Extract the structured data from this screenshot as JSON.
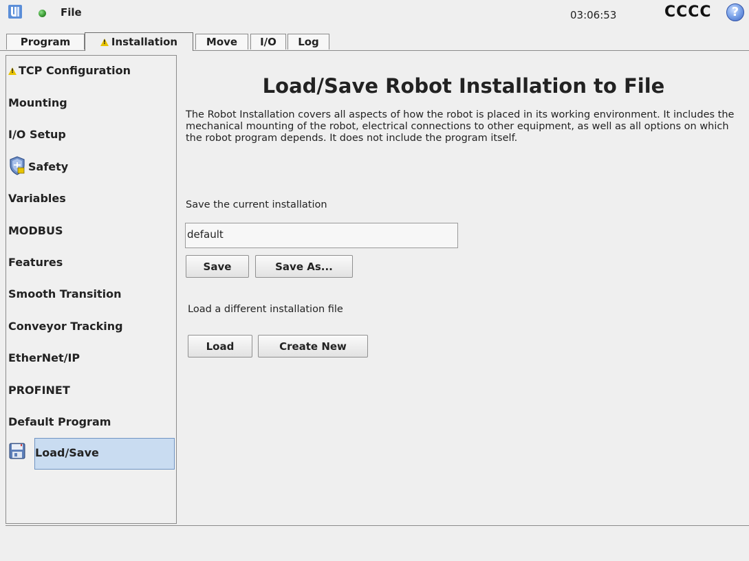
{
  "header": {
    "file_label": "File",
    "clock": "03:06:53",
    "robot_name": "CCCC",
    "help_symbol": "?",
    "status_color": "#3a9a33"
  },
  "tabs": [
    {
      "label": "Program",
      "active": false
    },
    {
      "label": "Installation",
      "active": true,
      "warning": true
    },
    {
      "label": "Move",
      "active": false
    },
    {
      "label": "I/O",
      "active": false
    },
    {
      "label": "Log",
      "active": false
    }
  ],
  "sidebar": {
    "items": [
      {
        "label": "TCP Configuration",
        "icon": "warning-icon"
      },
      {
        "label": "Mounting"
      },
      {
        "label": "I/O Setup"
      },
      {
        "label": "Safety",
        "icon": "safety-shield-icon"
      },
      {
        "label": "Variables"
      },
      {
        "label": "MODBUS"
      },
      {
        "label": "Features"
      },
      {
        "label": "Smooth Transition"
      },
      {
        "label": "Conveyor Tracking"
      },
      {
        "label": "EtherNet/IP"
      },
      {
        "label": "PROFINET"
      },
      {
        "label": "Default Program"
      },
      {
        "label": "Load/Save",
        "icon": "floppy-disk-icon",
        "selected": true
      }
    ]
  },
  "main": {
    "title": "Load/Save Robot Installation to File",
    "description": "The Robot Installation covers all aspects of how the robot is placed in its working environment. It includes the mechanical mounting of the robot, electrical connections to other equipment, as well as all options on which the robot program depends. It does not include the program itself.",
    "save_section_label": "Save the current installation",
    "installation_name": "default",
    "save_button": "Save",
    "save_as_button": "Save As...",
    "load_section_label": "Load a different installation file",
    "load_button": "Load",
    "create_new_button": "Create New"
  },
  "colors": {
    "background": "#efefef",
    "selected_item": "#c9dcf1",
    "warning": "#e8c300",
    "help_button": "#3c66c4"
  }
}
